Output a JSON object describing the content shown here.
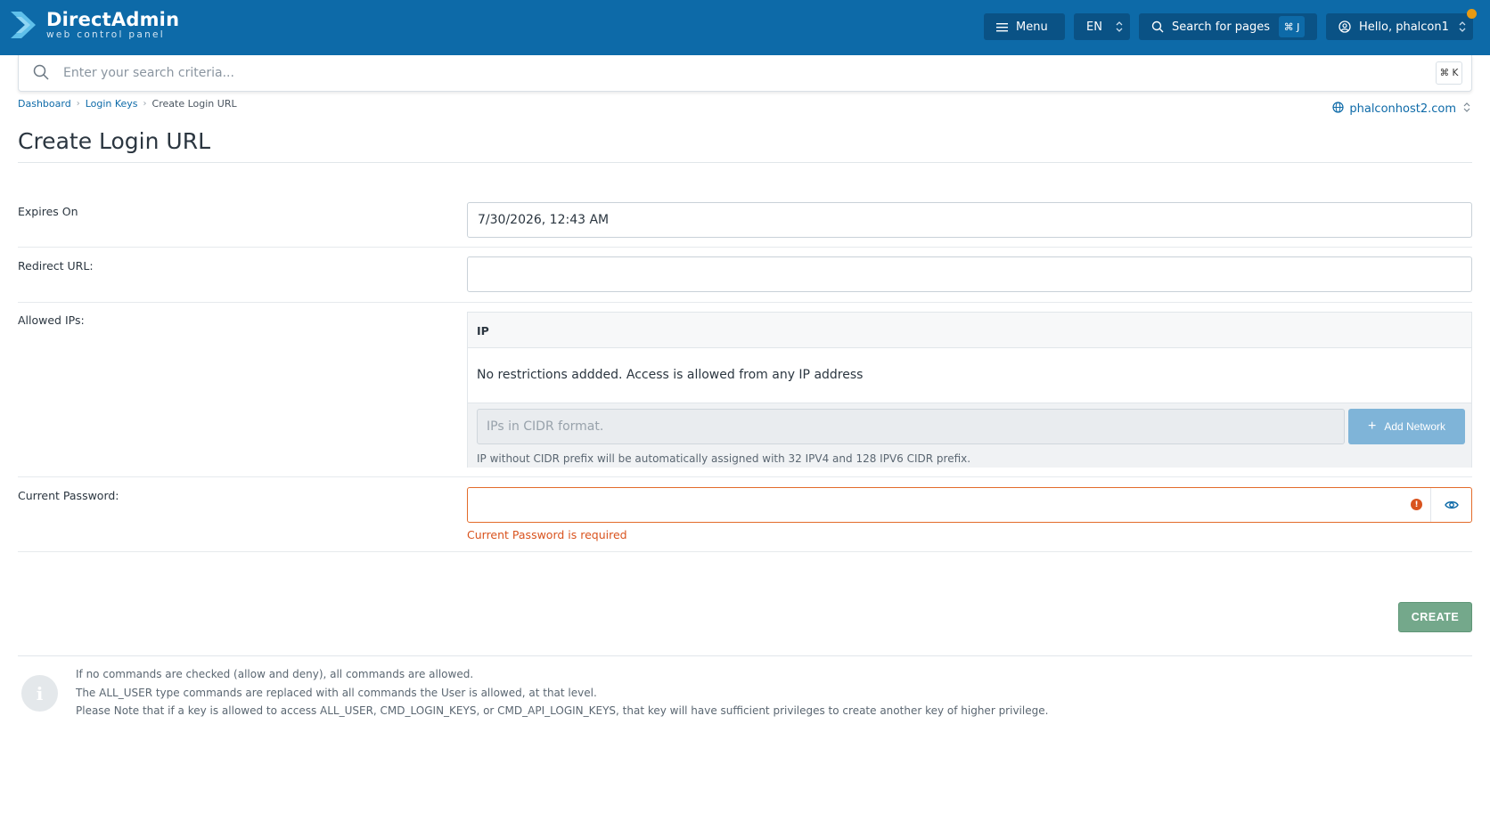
{
  "brand": {
    "title": "DirectAdmin",
    "subtitle": "web control panel"
  },
  "header": {
    "menu_label": "Menu",
    "lang_label": "EN",
    "search_label": "Search for pages",
    "search_shortcut": "⌘ J",
    "user_label": "Hello, phalcon1"
  },
  "searchbar": {
    "placeholder": "Enter your search criteria...",
    "shortcut": "⌘ K"
  },
  "breadcrumb": [
    "Dashboard",
    "Login Keys",
    "Create Login URL"
  ],
  "domain": "phalconhost2.com",
  "page_title": "Create Login URL",
  "form": {
    "expires_label": "Expires On",
    "expires_value": "7/30/2026, 12:43 AM",
    "redirect_label": "Redirect URL:",
    "redirect_value": "",
    "allowed_ips_label": "Allowed IPs:",
    "ip_column": "IP",
    "ip_empty": "No restrictions addded. Access is allowed from any IP address",
    "ip_placeholder": "IPs in CIDR format.",
    "add_network_label": "Add Network",
    "ip_hint": "IP without CIDR prefix will be automatically assigned with 32 IPV4 and 128 IPV6 CIDR prefix.",
    "password_label": "Current Password:",
    "password_value": "",
    "password_error": "Current Password is required",
    "create_label": "CREATE"
  },
  "notes": [
    "If no commands are checked (allow and deny), all commands are allowed.",
    "The ALL_USER type commands are replaced with all commands the User is allowed, at that level.",
    "Please Note that if a key is allowed to access ALL_USER, CMD_LOGIN_KEYS, or CMD_API_LOGIN_KEYS, that key will have sufficient privileges to create another key of higher privilege."
  ],
  "colors": {
    "header": "#0d6aa8",
    "error": "#d9531e",
    "create": "#74a88b",
    "add_network": "#7fb4d8",
    "notification": "#e89a12"
  }
}
